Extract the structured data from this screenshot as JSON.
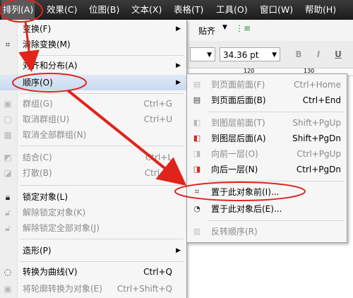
{
  "menubar": {
    "items": [
      {
        "label": "排列(A)"
      },
      {
        "label": "效果(C)"
      },
      {
        "label": "位图(B)"
      },
      {
        "label": "文本(X)"
      },
      {
        "label": "表格(T)"
      },
      {
        "label": "工具(O)"
      },
      {
        "label": "窗口(W)"
      },
      {
        "label": "帮助(H)"
      }
    ]
  },
  "toolbar": {
    "paste_label": "贴齐",
    "font_size": "34.36 pt",
    "bold": "B",
    "italic": "I",
    "underline": "U"
  },
  "ruler": {
    "ticks": [
      "120",
      "130"
    ]
  },
  "arrange_menu": {
    "items": [
      {
        "label": "变换(F)",
        "icon": "none",
        "shortcut": "",
        "arrow": "▶",
        "disabled": false
      },
      {
        "label": "清除变换(M)",
        "icon": "clear-transform-icon",
        "shortcut": "",
        "disabled": false
      },
      {
        "label": "对齐和分布(A)",
        "icon": "none",
        "shortcut": "",
        "arrow": "▶",
        "disabled": false
      },
      {
        "label": "顺序(O)",
        "icon": "none",
        "shortcut": "",
        "arrow": "▶",
        "disabled": false
      },
      {
        "label": "群组(G)",
        "icon": "group-icon",
        "shortcut": "Ctrl+G",
        "disabled": true
      },
      {
        "label": "取消群组(U)",
        "icon": "ungroup-icon",
        "shortcut": "Ctrl+U",
        "disabled": true
      },
      {
        "label": "取消全部群组(N)",
        "icon": "ungroup-all-icon",
        "shortcut": "",
        "disabled": true
      },
      {
        "label": "结合(C)",
        "icon": "combine-icon",
        "shortcut": "Ctrl+L",
        "disabled": true
      },
      {
        "label": "打散(B)",
        "icon": "break-apart-icon",
        "shortcut": "Ctrl+K",
        "disabled": true
      },
      {
        "label": "锁定对象(L)",
        "icon": "lock-icon",
        "shortcut": "",
        "disabled": false
      },
      {
        "label": "解除锁定对象(K)",
        "icon": "unlock-icon",
        "shortcut": "",
        "disabled": true
      },
      {
        "label": "解除锁定全部对象(J)",
        "icon": "unlock-all-icon",
        "shortcut": "",
        "disabled": true
      },
      {
        "label": "造形(P)",
        "icon": "none",
        "shortcut": "",
        "arrow": "▶",
        "disabled": false
      },
      {
        "label": "转换为曲线(V)",
        "icon": "convert-to-curves-icon",
        "shortcut": "Ctrl+Q",
        "disabled": false
      },
      {
        "label": "将轮廓转换为对象(E)",
        "icon": "outline-to-object-icon",
        "shortcut": "Ctrl+Shift+Q",
        "disabled": true
      }
    ]
  },
  "order_submenu": {
    "items": [
      {
        "label": "到页面前面(F)",
        "icon": "to-page-front-icon",
        "shortcut": "Ctrl+Home",
        "disabled": true
      },
      {
        "label": "到页面后面(B)",
        "icon": "to-page-back-icon",
        "shortcut": "Ctrl+End",
        "disabled": false
      },
      {
        "label": "到图层前面(T)",
        "icon": "to-layer-front-icon",
        "shortcut": "Shift+PgUp",
        "disabled": true
      },
      {
        "label": "到图层后面(A)",
        "icon": "to-layer-back-icon",
        "shortcut": "Shift+PgDn",
        "disabled": false
      },
      {
        "label": "向前一层(O)",
        "icon": "forward-one-icon",
        "shortcut": "Ctrl+PgUp",
        "disabled": true
      },
      {
        "label": "向后一层(N)",
        "icon": "back-one-icon",
        "shortcut": "Ctrl+PgDn",
        "disabled": false
      },
      {
        "label": "置于此对象前(I)...",
        "icon": "in-front-of-icon",
        "shortcut": "",
        "disabled": false
      },
      {
        "label": "置于此对象后(E)...",
        "icon": "behind-icon",
        "shortcut": "",
        "disabled": false
      },
      {
        "label": "反转顺序(R)",
        "icon": "reverse-order-icon",
        "shortcut": "",
        "disabled": true
      }
    ]
  },
  "colors": {
    "menubar_bg": "#1c1c1c",
    "menu_bg": "#f6f6f6",
    "highlight": "#c9dbf1",
    "disabled_text": "#8a8a8a",
    "annotation_red": "#e0241b"
  }
}
